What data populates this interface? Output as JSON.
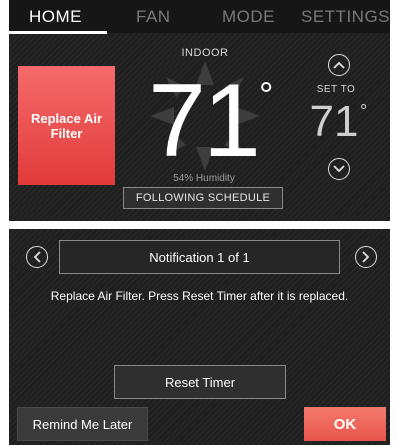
{
  "tabs": [
    {
      "label": "HOME",
      "active": true
    },
    {
      "label": "FAN",
      "active": false
    },
    {
      "label": "MODE",
      "active": false
    },
    {
      "label": "SETTINGS",
      "active": false
    }
  ],
  "home": {
    "replace_filter_label": "Replace Air\nFilter",
    "indoor_label": "INDOOR",
    "indoor_temp": "71",
    "degree_symbol": "°",
    "humidity": "54% Humidity",
    "schedule_label": "FOLLOWING SCHEDULE",
    "set_to_label": "SET TO",
    "setpoint": "71",
    "up_icon": "chevron-up-icon",
    "down_icon": "chevron-down-icon"
  },
  "notification": {
    "header": "Notification 1 of 1",
    "message": "Replace Air Filter. Press Reset Timer after it is replaced.",
    "prev_icon": "chevron-left-icon",
    "next_icon": "chevron-right-icon",
    "reset_label": "Reset Timer",
    "remind_label": "Remind Me Later",
    "ok_label": "OK"
  },
  "colors": {
    "background": "#1f1f1f",
    "accent_red": "#e8554a",
    "text": "#ffffff"
  }
}
